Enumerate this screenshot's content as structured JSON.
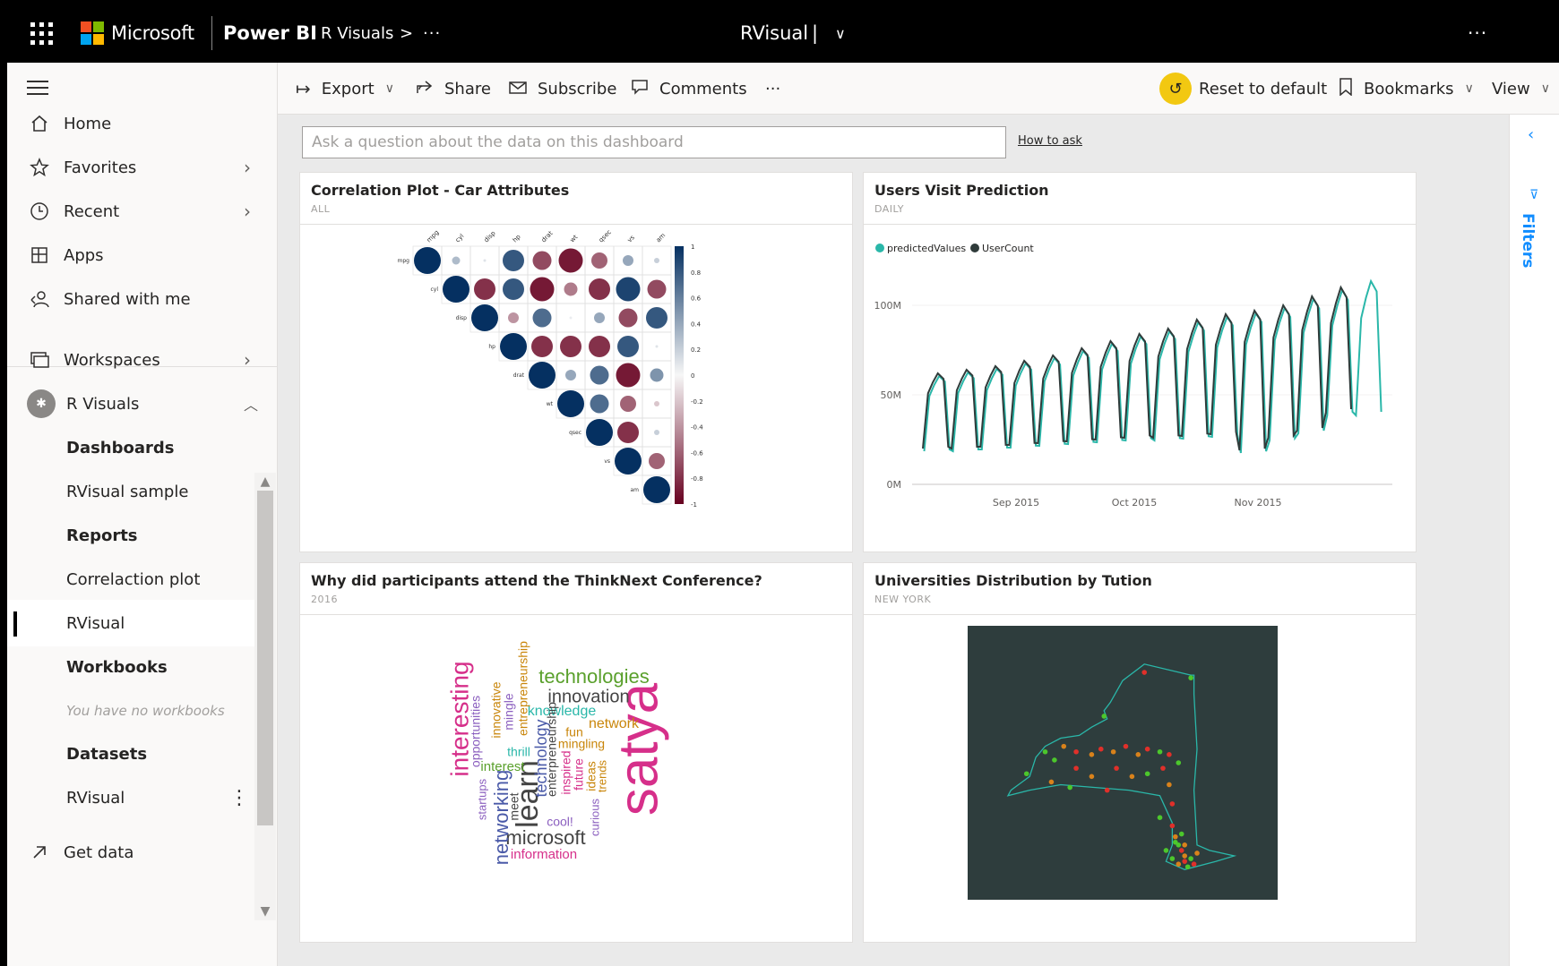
{
  "topbar": {
    "brand": "Microsoft",
    "product": "Power BI",
    "workspace_crumb": "R Visuals",
    "crumb_chevron": ">",
    "crumb_more": "···",
    "report_title": "RVisual",
    "title_caret": "|",
    "title_dropdown": "∨",
    "more": "···"
  },
  "leftnav": {
    "top_items": [
      {
        "label": "Home",
        "icon": "home-icon"
      },
      {
        "label": "Favorites",
        "icon": "star-icon"
      },
      {
        "label": "Recent",
        "icon": "clock-icon"
      },
      {
        "label": "Apps",
        "icon": "apps-icon"
      },
      {
        "label": "Shared with me",
        "icon": "shared-icon"
      }
    ],
    "workspaces_label": "Workspaces",
    "current_workspace": "R Visuals",
    "workspace_sections": [
      {
        "label": "Dashboards",
        "kind": "header"
      },
      {
        "label": "RVisual sample",
        "kind": "item"
      },
      {
        "label": "Reports",
        "kind": "header"
      },
      {
        "label": "Correlaction plot",
        "kind": "item"
      },
      {
        "label": "RVisual",
        "kind": "active"
      },
      {
        "label": "Workbooks",
        "kind": "header"
      },
      {
        "label": "You have no workbooks",
        "kind": "empty"
      },
      {
        "label": "Datasets",
        "kind": "header"
      },
      {
        "label": "RVisual",
        "kind": "item"
      }
    ],
    "get_data": "Get data"
  },
  "actionbar": {
    "export": "Export",
    "share": "Share",
    "subscribe": "Subscribe",
    "comments": "Comments",
    "more": "···",
    "reset": "Reset to default",
    "bookmarks": "Bookmarks",
    "view": "View"
  },
  "qa": {
    "placeholder": "Ask a question about the data on this dashboard",
    "how_to_ask": "How to ask"
  },
  "filters": {
    "label": "Filters"
  },
  "tiles": {
    "corr": {
      "title": "Correlation Plot - Car Attributes",
      "subtitle": "ALL"
    },
    "visits": {
      "title": "Users Visit Prediction",
      "subtitle": "DAILY"
    },
    "wordcloud": {
      "title": "Why did participants attend the ThinkNext Conference?",
      "subtitle": "2016"
    },
    "map": {
      "title": "Universities Distribution by Tution",
      "subtitle": "NEW YORK"
    }
  },
  "colors": {
    "accent": "#118dff",
    "reset_badge": "#f2c811",
    "predicted": "#2ab7a9",
    "usercount": "#2f3b3a",
    "map_bg": "#2e3d3d",
    "map_outline": "#2ab7a9"
  },
  "chart_data": [
    {
      "type": "heatmap",
      "subtype": "correlation-upper-triangle",
      "variables": [
        "mpg",
        "cyl",
        "disp",
        "hp",
        "drat",
        "wt",
        "qsec",
        "vs",
        "am"
      ],
      "color_scale": {
        "min": -1,
        "max": 1,
        "ticks": [
          "1",
          "0.8",
          "0.6",
          "0.4",
          "0.2",
          "0",
          "-0.2",
          "-0.4",
          "-0.6",
          "-0.8",
          "-1"
        ]
      },
      "matrix": [
        [
          1,
          0.3,
          0.1,
          0.8,
          -0.7,
          -0.9,
          -0.6,
          0.4,
          0.2
        ],
        [
          0.3,
          1,
          -0.8,
          0.8,
          -0.9,
          -0.5,
          -0.8,
          0.9,
          -0.7
        ],
        [
          0.1,
          -0.8,
          1,
          -0.4,
          0.7,
          0.05,
          0.4,
          -0.7,
          0.8
        ],
        [
          0.8,
          0.8,
          -0.4,
          1,
          -0.8,
          -0.8,
          -0.8,
          0.8,
          0.1
        ],
        [
          -0.7,
          -0.9,
          0.7,
          -0.8,
          1,
          0.4,
          0.7,
          -0.9,
          0.5
        ],
        [
          -0.9,
          -0.5,
          0.05,
          -0.8,
          0.4,
          1,
          0.7,
          -0.6,
          -0.2
        ],
        [
          -0.6,
          -0.8,
          0.4,
          -0.8,
          0.7,
          0.7,
          1,
          -0.8,
          0.2
        ],
        [
          0.4,
          0.9,
          -0.7,
          0.8,
          -0.9,
          -0.6,
          -0.8,
          1,
          -0.6
        ],
        [
          0.2,
          -0.7,
          0.8,
          0.1,
          0.5,
          -0.2,
          0.2,
          -0.6,
          1
        ]
      ]
    },
    {
      "type": "line",
      "legend": [
        "predictedValues",
        "UserCount"
      ],
      "legend_position": "top-left",
      "y_ticks": [
        "100M",
        "50M",
        "0M"
      ],
      "ylim": [
        0,
        120000000
      ],
      "x_ticks": [
        "Sep 2015",
        "Oct 2015",
        "Nov 2015"
      ],
      "pattern": "weekly seasonal, rising trend",
      "weeks": [
        {
          "high": 62,
          "low": 20
        },
        {
          "high": 64,
          "low": 20
        },
        {
          "high": 66,
          "low": 21
        },
        {
          "high": 69,
          "low": 22
        },
        {
          "high": 72,
          "low": 23
        },
        {
          "high": 76,
          "low": 24
        },
        {
          "high": 80,
          "low": 25
        },
        {
          "high": 84,
          "low": 26
        },
        {
          "high": 87,
          "low": 26
        },
        {
          "high": 92,
          "low": 27
        },
        {
          "high": 95,
          "low": 28
        },
        {
          "high": 97,
          "low": 19
        },
        {
          "high": 100,
          "low": 26
        },
        {
          "high": 105,
          "low": 30
        },
        {
          "high": 110,
          "low": 40
        }
      ],
      "predicted_extension": [
        {
          "high": 115,
          "low": 40
        }
      ]
    },
    {
      "type": "other",
      "subtype": "wordcloud",
      "words": [
        {
          "text": "satya",
          "size": 62,
          "color": "#d62f8a",
          "vertical": true
        },
        {
          "text": "interesting",
          "size": 28,
          "color": "#d62f8a",
          "vertical": true
        },
        {
          "text": "technologies",
          "size": 22,
          "color": "#5aa02c",
          "vertical": false
        },
        {
          "text": "innovation",
          "size": 20,
          "color": "#444444",
          "vertical": false
        },
        {
          "text": "learn",
          "size": 34,
          "color": "#444444",
          "vertical": true
        },
        {
          "text": "microsoft",
          "size": 22,
          "color": "#444444",
          "vertical": false
        },
        {
          "text": "networking",
          "size": 22,
          "color": "#4a5aa8",
          "vertical": true
        },
        {
          "text": "technology",
          "size": 18,
          "color": "#4a5aa8",
          "vertical": true
        },
        {
          "text": "knowledge",
          "size": 16,
          "color": "#2ab7a9",
          "vertical": false
        },
        {
          "text": "network",
          "size": 16,
          "color": "#c9860b",
          "vertical": false
        },
        {
          "text": "entrepreneurship",
          "size": 14,
          "color": "#c9860b",
          "vertical": true
        },
        {
          "text": "opportunities",
          "size": 14,
          "color": "#8b5fbf",
          "vertical": true
        },
        {
          "text": "innovative",
          "size": 14,
          "color": "#c9860b",
          "vertical": true
        },
        {
          "text": "mingle",
          "size": 14,
          "color": "#8b5fbf",
          "vertical": true
        },
        {
          "text": "enterpreneurship",
          "size": 14,
          "color": "#444444",
          "vertical": true
        },
        {
          "text": "fun",
          "size": 14,
          "color": "#c9860b",
          "vertical": false
        },
        {
          "text": "mingling",
          "size": 14,
          "color": "#c9860b",
          "vertical": false
        },
        {
          "text": "interest",
          "size": 15,
          "color": "#5aa02c",
          "vertical": false
        },
        {
          "text": "thrill",
          "size": 14,
          "color": "#2ab7a9",
          "vertical": false
        },
        {
          "text": "startups",
          "size": 13,
          "color": "#8b5fbf",
          "vertical": true
        },
        {
          "text": "meet",
          "size": 14,
          "color": "#444444",
          "vertical": true
        },
        {
          "text": "inspired",
          "size": 14,
          "color": "#d62f8a",
          "vertical": true
        },
        {
          "text": "future",
          "size": 14,
          "color": "#d62f8a",
          "vertical": true
        },
        {
          "text": "ideas",
          "size": 14,
          "color": "#c9860b",
          "vertical": true
        },
        {
          "text": "trends",
          "size": 13,
          "color": "#c9860b",
          "vertical": true
        },
        {
          "text": "cool!",
          "size": 14,
          "color": "#8b5fbf",
          "vertical": false
        },
        {
          "text": "curious",
          "size": 13,
          "color": "#8b5fbf",
          "vertical": true
        },
        {
          "text": "information",
          "size": 15,
          "color": "#d62f8a",
          "vertical": false
        }
      ]
    },
    {
      "type": "scatter",
      "subtype": "map",
      "region": "New York State",
      "series": [
        {
          "name": "green",
          "color": "#4cc72c"
        },
        {
          "name": "orange",
          "color": "#d8821b"
        },
        {
          "name": "red",
          "color": "#e0302a"
        }
      ],
      "points": [
        [
          0.57,
          0.17,
          "red"
        ],
        [
          0.72,
          0.19,
          "green"
        ],
        [
          0.44,
          0.33,
          "green"
        ],
        [
          0.25,
          0.46,
          "green"
        ],
        [
          0.28,
          0.49,
          "green"
        ],
        [
          0.19,
          0.54,
          "green"
        ],
        [
          0.31,
          0.44,
          "orange"
        ],
        [
          0.35,
          0.46,
          "red"
        ],
        [
          0.4,
          0.47,
          "orange"
        ],
        [
          0.43,
          0.45,
          "red"
        ],
        [
          0.47,
          0.46,
          "orange"
        ],
        [
          0.51,
          0.44,
          "red"
        ],
        [
          0.55,
          0.47,
          "orange"
        ],
        [
          0.58,
          0.45,
          "red"
        ],
        [
          0.62,
          0.46,
          "green"
        ],
        [
          0.65,
          0.47,
          "red"
        ],
        [
          0.68,
          0.5,
          "green"
        ],
        [
          0.35,
          0.52,
          "red"
        ],
        [
          0.4,
          0.55,
          "orange"
        ],
        [
          0.48,
          0.52,
          "red"
        ],
        [
          0.53,
          0.55,
          "orange"
        ],
        [
          0.58,
          0.54,
          "green"
        ],
        [
          0.63,
          0.52,
          "red"
        ],
        [
          0.27,
          0.57,
          "orange"
        ],
        [
          0.33,
          0.59,
          "green"
        ],
        [
          0.45,
          0.6,
          "red"
        ],
        [
          0.65,
          0.58,
          "orange"
        ],
        [
          0.66,
          0.65,
          "red"
        ],
        [
          0.62,
          0.7,
          "green"
        ],
        [
          0.66,
          0.73,
          "red"
        ],
        [
          0.67,
          0.77,
          "orange"
        ],
        [
          0.68,
          0.8,
          "green"
        ],
        [
          0.69,
          0.82,
          "red"
        ],
        [
          0.7,
          0.84,
          "orange"
        ],
        [
          0.66,
          0.85,
          "green"
        ],
        [
          0.7,
          0.86,
          "red"
        ],
        [
          0.72,
          0.85,
          "green"
        ],
        [
          0.74,
          0.83,
          "orange"
        ],
        [
          0.64,
          0.82,
          "green"
        ],
        [
          0.68,
          0.87,
          "orange"
        ],
        [
          0.71,
          0.88,
          "green"
        ],
        [
          0.73,
          0.87,
          "red"
        ],
        [
          0.67,
          0.79,
          "green"
        ],
        [
          0.7,
          0.8,
          "orange"
        ],
        [
          0.69,
          0.76,
          "green"
        ]
      ]
    }
  ]
}
